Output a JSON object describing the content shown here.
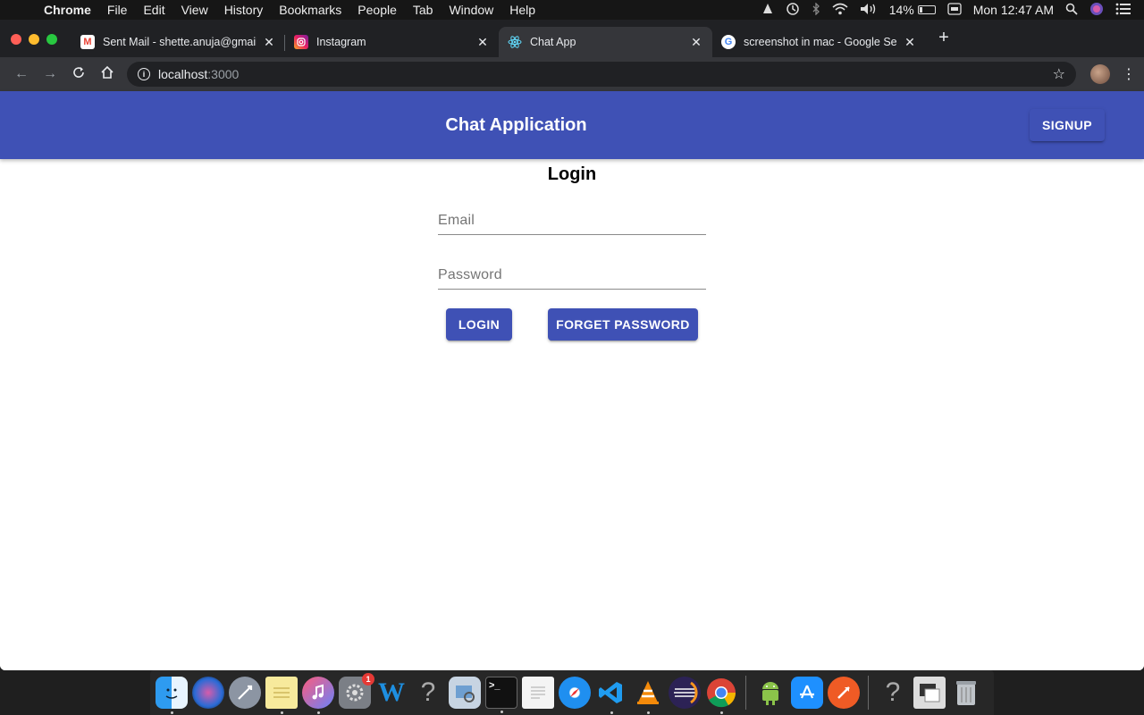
{
  "menubar": {
    "app_name": "Chrome",
    "menus": [
      "File",
      "Edit",
      "View",
      "History",
      "Bookmarks",
      "People",
      "Tab",
      "Window",
      "Help"
    ],
    "battery_percent": "14%",
    "clock": "Mon 12:47 AM"
  },
  "browser": {
    "tabs": [
      {
        "title": "Sent Mail - shette.anuja@gmail",
        "icon": "gmail-icon",
        "active": false
      },
      {
        "title": "Instagram",
        "icon": "instagram-icon",
        "active": false
      },
      {
        "title": "Chat App",
        "icon": "react-icon",
        "active": true
      },
      {
        "title": "screenshot in mac - Google Se",
        "icon": "google-icon",
        "active": false
      }
    ],
    "url_host": "localhost",
    "url_port": ":3000"
  },
  "app": {
    "title": "Chat Application",
    "signup_label": "SIGNUP",
    "login_heading": "Login",
    "email_placeholder": "Email",
    "password_placeholder": "Password",
    "login_label": "LOGIN",
    "forget_label": "FORGET PASSWORD",
    "primary_color": "#3f51b5"
  },
  "dock": {
    "apps": [
      "finder-icon",
      "siri-icon",
      "launchpad-icon",
      "notes-icon",
      "itunes-icon",
      "system-preferences-icon",
      "word-icon",
      "unknown-app-icon",
      "preview-icon",
      "terminal-icon",
      "textedit-icon",
      "safari-icon",
      "vscode-icon",
      "vlc-icon",
      "eclipse-icon",
      "chrome-icon",
      "android-studio-icon",
      "app-store-icon",
      "postman-icon",
      "unknown-app-icon",
      "downloads-icon",
      "trash-icon"
    ],
    "system_preferences_badge": "1",
    "terminal_glyph": ">_"
  }
}
